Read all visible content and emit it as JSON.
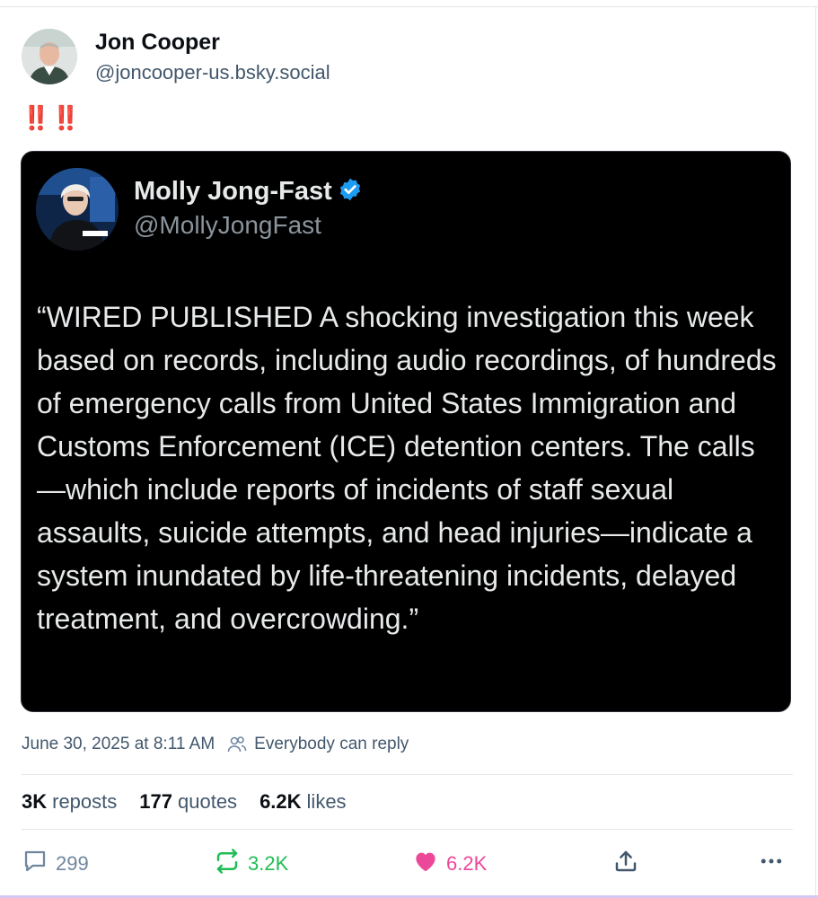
{
  "post": {
    "author": {
      "name": "Jon Cooper",
      "handle": "@joncooper-us.bsky.social"
    },
    "text": "‼️‼️",
    "quoted": {
      "name": "Molly Jong-Fast",
      "handle": "@MollyJongFast",
      "body": "“WIRED PUBLISHED A shocking investigation this week based on records, including audio recordings, of hundreds of emergency calls from United States Immigration and Customs Enforcement (ICE) detention centers. The calls—which include reports of incidents of staff sexual assaults, suicide attempts, and head injuries—indicate a system inundated by life-threatening incidents, delayed treatment, and overcrowding.”"
    },
    "timestamp": "June 30, 2025 at 8:11 AM",
    "reply_setting": "Everybody can reply",
    "stats": {
      "reposts_count": "3K",
      "reposts_label": "reposts",
      "quotes_count": "177",
      "quotes_label": "quotes",
      "likes_count": "6.2K",
      "likes_label": "likes"
    },
    "actions": {
      "reply_count": "299",
      "repost_count": "3.2K",
      "like_count": "6.2K"
    }
  },
  "colors": {
    "accent_red": "#e0263a",
    "repost_green": "#20bc54",
    "like_pink": "#ec4899",
    "muted": "#42576c",
    "verified_blue": "#1d9bf0"
  },
  "icons": [
    "reply-icon",
    "repost-icon",
    "heart-icon",
    "share-icon",
    "more-icon",
    "people-icon",
    "verified-icon"
  ]
}
